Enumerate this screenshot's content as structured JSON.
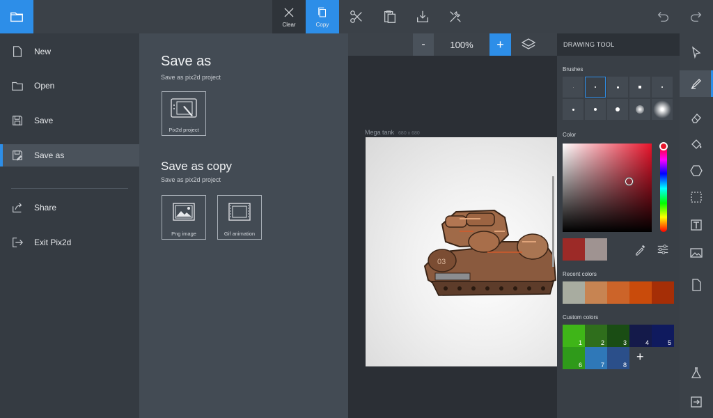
{
  "toolbar": {
    "clear_label": "Clear",
    "copy_label": "Copy",
    "buttons": [
      "menu",
      "clear",
      "copy",
      "cut",
      "paste",
      "import",
      "tools",
      "undo",
      "redo"
    ]
  },
  "menu": {
    "items": [
      {
        "label": "New",
        "icon": "new-file-icon"
      },
      {
        "label": "Open",
        "icon": "folder-icon"
      },
      {
        "label": "Save",
        "icon": "save-icon"
      },
      {
        "label": "Save as",
        "icon": "save-as-icon",
        "active": true
      },
      {
        "label": "Share",
        "icon": "share-icon"
      },
      {
        "label": "Exit Pix2d",
        "icon": "exit-icon"
      }
    ]
  },
  "save_panel": {
    "save_as_title": "Save as",
    "save_as_sub": "Save as pix2d project",
    "save_as_tile": "Pix2d project",
    "save_copy_title": "Save as copy",
    "save_copy_sub": "Save as pix2d project",
    "png_tile": "Png image",
    "gif_tile": "Gif animation"
  },
  "canvas": {
    "zoom_minus": "-",
    "zoom_value": "100%",
    "zoom_plus": "+",
    "title": "Mega tank",
    "dimensions": "680 x 680"
  },
  "drawing_tool": {
    "header": "DRAWING TOOL",
    "brushes_label": "Brushes",
    "color_label": "Color",
    "recent_label": "Recent colors",
    "custom_label": "Custom colors",
    "add_label": "+",
    "primary_color": "#9c2a27",
    "secondary_color": "#9f9391",
    "recent_colors": [
      "#a8aca0",
      "#c78452",
      "#cc6429",
      "#c94b0b",
      "#a52e06"
    ],
    "custom_colors": [
      {
        "num": "1",
        "color": "#3fb518"
      },
      {
        "num": "2",
        "color": "#2f6e1c"
      },
      {
        "num": "3",
        "color": "#1a4d14"
      },
      {
        "num": "4",
        "color": "#141a4a"
      },
      {
        "num": "5",
        "color": "#0f1a5e"
      },
      {
        "num": "6",
        "color": "#2f9a1a"
      },
      {
        "num": "7",
        "color": "#2f78b8"
      },
      {
        "num": "8",
        "color": "#2b4f8a"
      }
    ]
  }
}
